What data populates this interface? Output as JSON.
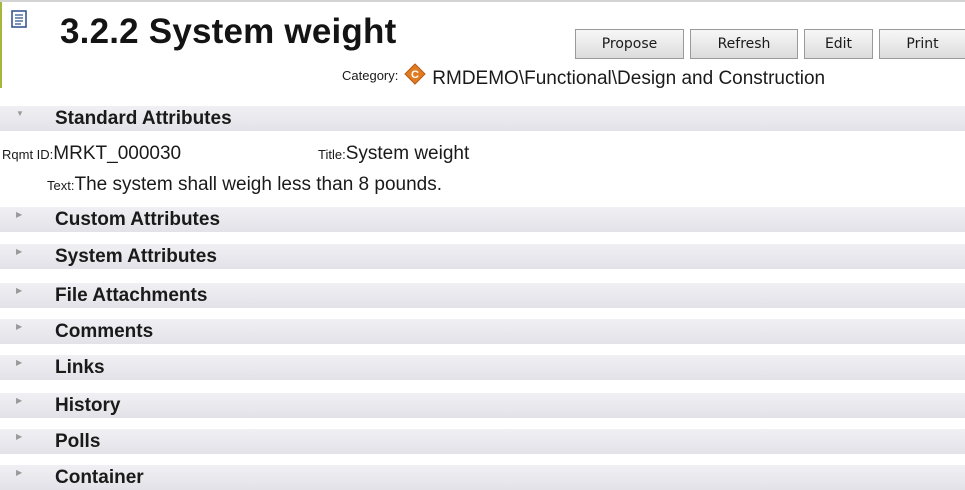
{
  "header": {
    "title": "3.2.2 System weight",
    "buttons": {
      "propose": "Propose",
      "refresh": "Refresh",
      "edit": "Edit",
      "print": "Print"
    },
    "category_label": "Category:",
    "category_icon_letter": "C",
    "category_value": "RMDEMO\\Functional\\Design and Construction"
  },
  "sections": {
    "standard": "Standard Attributes",
    "custom": "Custom Attributes",
    "system": "System Attributes",
    "files": "File Attachments",
    "comments": "Comments",
    "links": "Links",
    "history": "History",
    "polls": "Polls",
    "container": "Container"
  },
  "attributes": {
    "rqmt_id_label": "Rqmt ID:",
    "rqmt_id": "MRKT_000030",
    "title_label": "Title:",
    "title": "System weight",
    "text_label": "Text:",
    "text": "The system shall weigh less than 8 pounds."
  },
  "colors": {
    "accent": "#a7b63c",
    "category_icon": "#e07b22",
    "section_bg": "#e6e6ec"
  },
  "arrows": {
    "expanded": "▼",
    "collapsed": "▶"
  }
}
